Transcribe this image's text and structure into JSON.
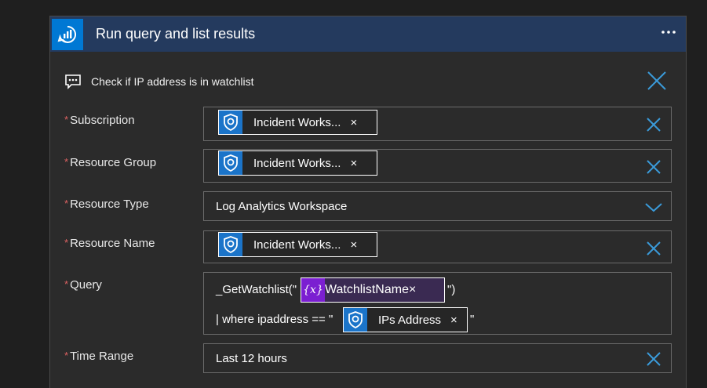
{
  "header": {
    "title": "Run query and list results",
    "more_label": "•••",
    "accent": "#243a5e"
  },
  "step_note": {
    "text": "Check if IP address is in watchlist"
  },
  "fields": {
    "subscription": {
      "label": "Subscription",
      "required_mark": "*",
      "token": "Incident Works...",
      "remove": "×"
    },
    "resource_group": {
      "label": "Resource Group",
      "required_mark": "*",
      "token": "Incident Works...",
      "remove": "×"
    },
    "resource_type": {
      "label": "Resource Type",
      "required_mark": "*",
      "value": "Log Analytics Workspace"
    },
    "resource_name": {
      "label": "Resource Name",
      "required_mark": "*",
      "token": "Incident Works...",
      "remove": "×"
    },
    "query": {
      "label": "Query",
      "required_mark": "*",
      "line1_prefix": "_GetWatchlist(\"",
      "line1_var_icon": "{x}",
      "line1_var": "WatchlistName",
      "line1_suffix": "\")",
      "line2_prefix": "| where ipaddress == \"",
      "line2_token": "IPs Address",
      "line2_suffix": "\"",
      "remove": "×"
    },
    "time_range": {
      "label": "Time Range",
      "required_mark": "*",
      "value": "Last 12 hours"
    }
  },
  "colors": {
    "required": "#e06363",
    "accent_blue": "#3a9ad9",
    "variable_purple": "#7b1fd1"
  }
}
